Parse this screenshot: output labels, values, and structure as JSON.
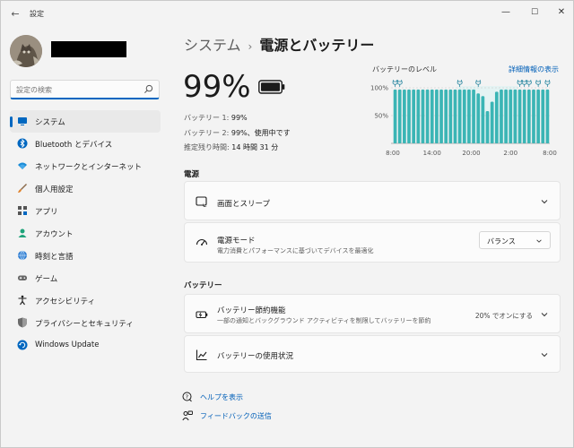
{
  "window": {
    "app_title": "設定",
    "back_glyph": "←",
    "min_glyph": "—",
    "max_glyph": "☐",
    "close_glyph": "✕"
  },
  "search": {
    "placeholder": "設定の検索"
  },
  "sidebar": {
    "items": [
      {
        "label": "システム",
        "icon": "monitor-icon",
        "active": true
      },
      {
        "label": "Bluetooth とデバイス",
        "icon": "bluetooth-icon",
        "active": false
      },
      {
        "label": "ネットワークとインターネット",
        "icon": "wifi-icon",
        "active": false
      },
      {
        "label": "個人用設定",
        "icon": "brush-icon",
        "active": false
      },
      {
        "label": "アプリ",
        "icon": "apps-icon",
        "active": false
      },
      {
        "label": "アカウント",
        "icon": "person-icon",
        "active": false
      },
      {
        "label": "時刻と言語",
        "icon": "globe-clock-icon",
        "active": false
      },
      {
        "label": "ゲーム",
        "icon": "gamepad-icon",
        "active": false
      },
      {
        "label": "アクセシビリティ",
        "icon": "accessibility-icon",
        "active": false
      },
      {
        "label": "プライバシーとセキュリティ",
        "icon": "shield-icon",
        "active": false
      },
      {
        "label": "Windows Update",
        "icon": "update-icon",
        "active": false
      }
    ]
  },
  "breadcrumb": {
    "parent": "システム",
    "separator": "›",
    "current": "電源とバッテリー"
  },
  "battery": {
    "percent": "99%",
    "line1_label": "バッテリー 1:",
    "line1_value": "99%",
    "line2_label": "バッテリー 2:",
    "line2_value": "99%、使用中です",
    "remaining_label": "推定残り時間:",
    "remaining_value": "14 時間 31 分"
  },
  "chart": {
    "title": "バッテリーのレベル",
    "link": "詳細情報の表示"
  },
  "chart_data": {
    "type": "bar",
    "y_tick_labels": [
      "100%",
      "50%"
    ],
    "x_tick_labels": [
      "8:00",
      "14:00",
      "20:00",
      "2:00",
      "8:00"
    ],
    "ylim": [
      0,
      100
    ],
    "values": [
      97,
      97,
      97,
      97,
      97,
      97,
      97,
      97,
      97,
      97,
      97,
      97,
      97,
      97,
      97,
      97,
      97,
      97,
      90,
      85,
      58,
      75,
      93,
      97,
      97,
      97,
      97,
      97,
      97,
      97,
      97,
      97,
      97,
      97
    ],
    "plugged_marker_positions": [
      0,
      1,
      14,
      18,
      27,
      28,
      29,
      31,
      33
    ],
    "bar_color": "#3bb5b5",
    "highlight_color": "#e4f3f3"
  },
  "sections": {
    "power_title": "電源",
    "battery_title": "バッテリー"
  },
  "cards": {
    "screen_sleep": {
      "title": "画面とスリープ"
    },
    "power_mode": {
      "title": "電源モード",
      "desc": "電力消費とパフォーマンスに基づいてデバイスを最適化",
      "selected": "バランス"
    },
    "battery_saver": {
      "title": "バッテリー節約機能",
      "desc": "一部の通知とバックグラウンド アクティビティを制限してバッテリーを節約",
      "status": "20% でオンにする"
    },
    "battery_usage": {
      "title": "バッテリーの使用状況"
    }
  },
  "help": {
    "help_link": "ヘルプを表示",
    "feedback_link": "フィードバックの送信"
  },
  "colors": {
    "accent": "#0067c0",
    "link": "#005fb8",
    "bar": "#3bb5b5"
  }
}
